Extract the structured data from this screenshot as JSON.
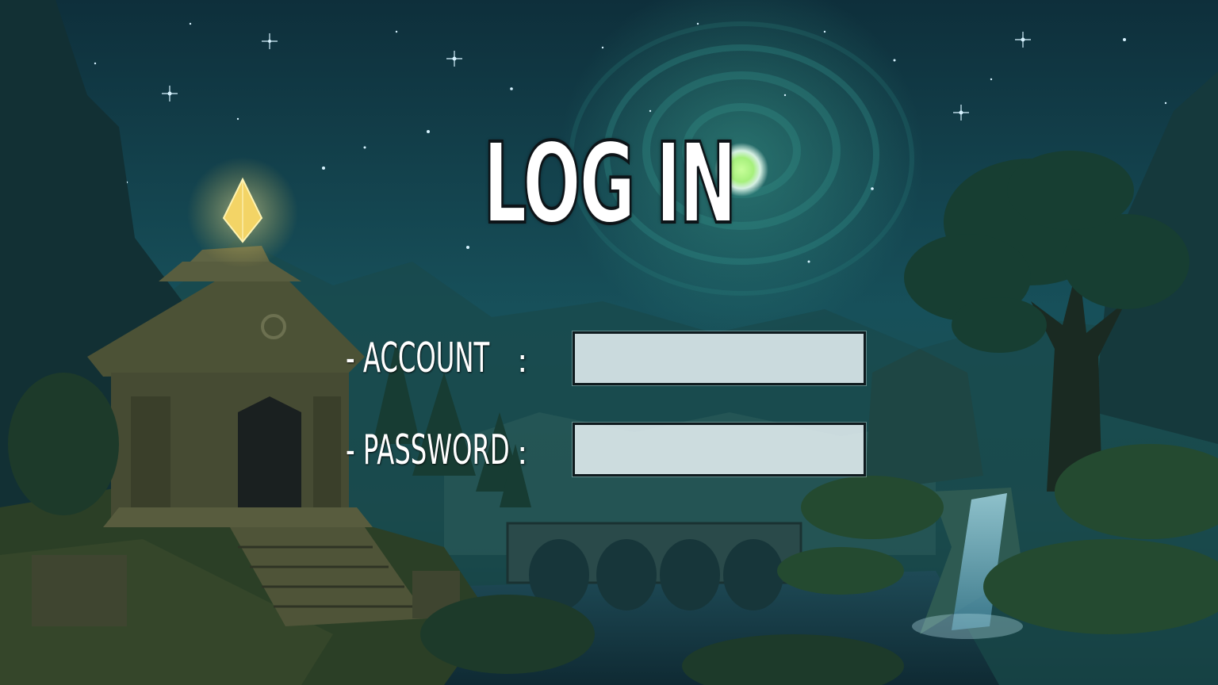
{
  "title": "LOG IN",
  "form": {
    "account": {
      "label": "- ACCOUNT",
      "separator": ":",
      "value": "",
      "placeholder": ""
    },
    "password": {
      "label": "- PASSWORD",
      "separator": ":",
      "value": "",
      "placeholder": ""
    }
  },
  "colors": {
    "sky": "#123a47",
    "moon_glow": "#b9ff9a",
    "crystal": "#f0d36a",
    "input_background": "#e8f2f4",
    "text": "#ffffff"
  }
}
